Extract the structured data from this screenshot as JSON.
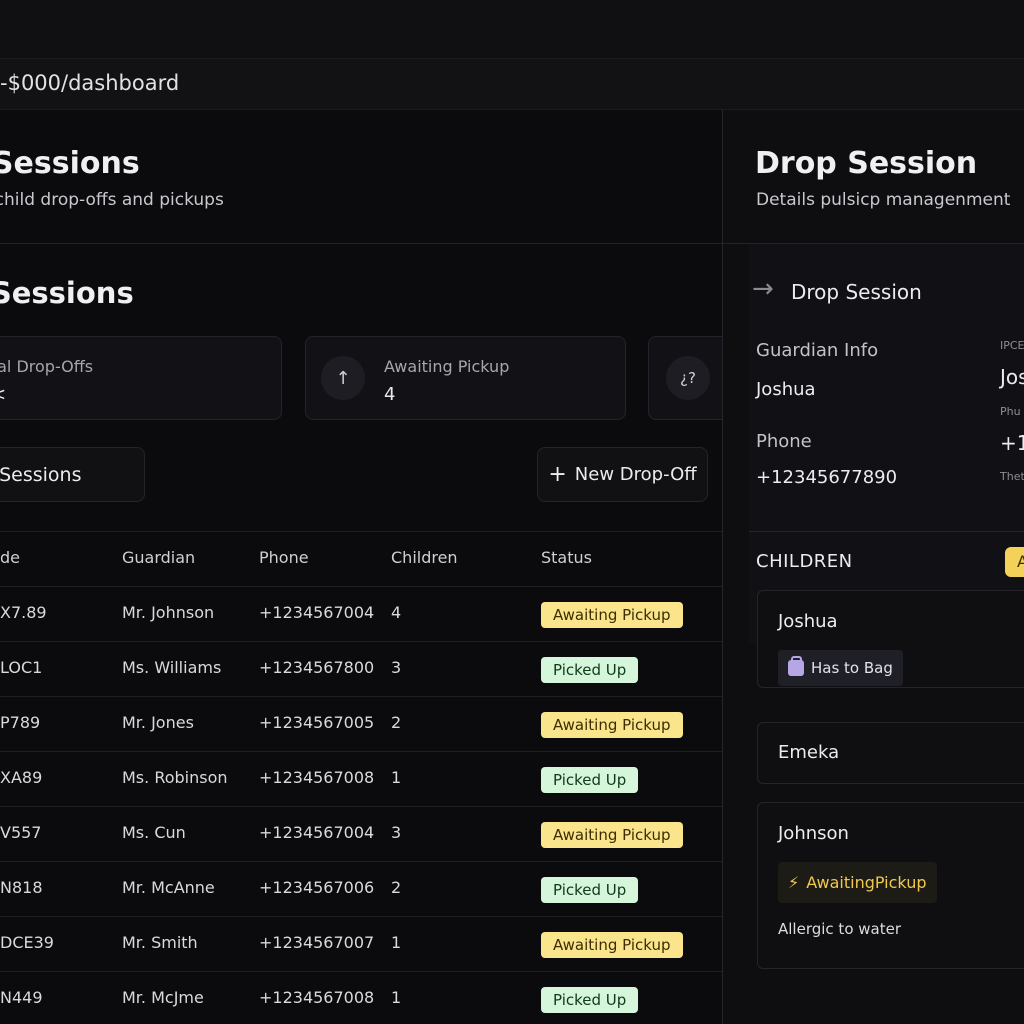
{
  "browser": {
    "url": "-$000/dashboard"
  },
  "main": {
    "title": "p Sessions",
    "subtitle": "ge child drop-offs and pickups",
    "section_title": "p Sessions",
    "stats": [
      {
        "label": "etal Drop-Offs",
        "value": "<",
        "icon": ""
      },
      {
        "label": "Awaiting Pickup",
        "value": "4",
        "icon": "arrow-up-icon"
      },
      {
        "label": "",
        "value": "",
        "icon": "question-icon"
      }
    ],
    "list_label": "p Sessions",
    "new_button": "New Drop-Off",
    "table": {
      "headers": [
        "de",
        "Guardian",
        "Phone",
        "Children",
        "Status"
      ],
      "rows": [
        {
          "code": "X7.89",
          "guardian": "Mr. Johnson",
          "phone": "+1234567004",
          "children": "4",
          "status": "Awaiting Pickup",
          "kind": "awaiting"
        },
        {
          "code": "LOC1",
          "guardian": "Ms. Williams",
          "phone": "+1234567800",
          "children": "3",
          "status": "Picked Up",
          "kind": "picked"
        },
        {
          "code": "P789",
          "guardian": "Mr. Jones",
          "phone": "+1234567005",
          "children": "2",
          "status": "Awaiting Pickup",
          "kind": "awaiting"
        },
        {
          "code": "XA89",
          "guardian": "Ms. Robinson",
          "phone": "+1234567008",
          "children": "1",
          "status": "Picked Up",
          "kind": "picked"
        },
        {
          "code": "V557",
          "guardian": "Ms. Cun",
          "phone": "+1234567004",
          "children": "3",
          "status": "Awaiting Pickup",
          "kind": "awaiting"
        },
        {
          "code": "N818",
          "guardian": "Mr. McAnne",
          "phone": "+1234567006",
          "children": "2",
          "status": "Picked Up",
          "kind": "picked"
        },
        {
          "code": "DCE39",
          "guardian": "Mr. Smith",
          "phone": "+1234567007",
          "children": "1",
          "status": "Awaiting Pickup",
          "kind": "awaiting"
        },
        {
          "code": "N449",
          "guardian": "Mr. McJme",
          "phone": "+1234567008",
          "children": "1",
          "status": "Picked Up",
          "kind": "picked"
        }
      ]
    }
  },
  "side": {
    "title": "Drop Session",
    "subtitle": "Details pulsicp managenment",
    "session_heading": "Drop Session",
    "guardian_label": "Guardian Info",
    "guardian_name": "Joshua",
    "phone_label": "Phone",
    "phone_value": "+12345677890",
    "right_col": {
      "label1": "IPCE",
      "value1": "Jos",
      "label2": "Phu",
      "value2": "+1",
      "label3": "Thet"
    },
    "children_title": "CHILDREN",
    "pill_text": "A",
    "children": [
      {
        "name": "Joshua",
        "tag": "Has to Bag"
      },
      {
        "name": "Emeka"
      },
      {
        "name": "Johnson",
        "tag": "AwaitingPickup",
        "note": "Allergic to water"
      }
    ]
  },
  "colors": {
    "background": "#0b0b0d",
    "awaiting_badge": "#fbe58c",
    "picked_badge": "#d6f6dc",
    "accent_yellow": "#f4d25a"
  }
}
